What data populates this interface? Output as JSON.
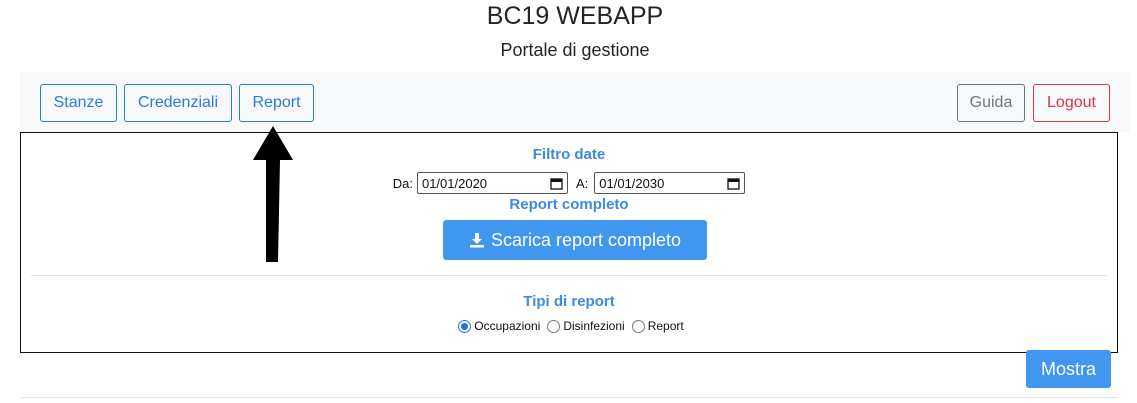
{
  "header": {
    "title": "BC19 WEBAPP",
    "subtitle": "Portale di gestione"
  },
  "navbar": {
    "stanze": "Stanze",
    "credenziali": "Credenziali",
    "report": "Report",
    "guida": "Guida",
    "logout": "Logout"
  },
  "filter": {
    "title": "Filtro date",
    "from_label": "Da:",
    "from_value": "01/01/2020",
    "to_label": "A:",
    "to_value": "01/01/2030"
  },
  "full_report": {
    "title": "Report completo",
    "download_label": "Scarica report completo",
    "download_icon": "download-icon"
  },
  "report_types": {
    "title": "Tipi di report",
    "options": [
      "Occupazioni",
      "Disinfezioni",
      "Report"
    ],
    "selected": "Occupazioni"
  },
  "actions": {
    "show_label": "Mostra"
  },
  "colors": {
    "accent": "#3f97f0",
    "danger": "#dc3545",
    "secondary": "#6c757d"
  }
}
